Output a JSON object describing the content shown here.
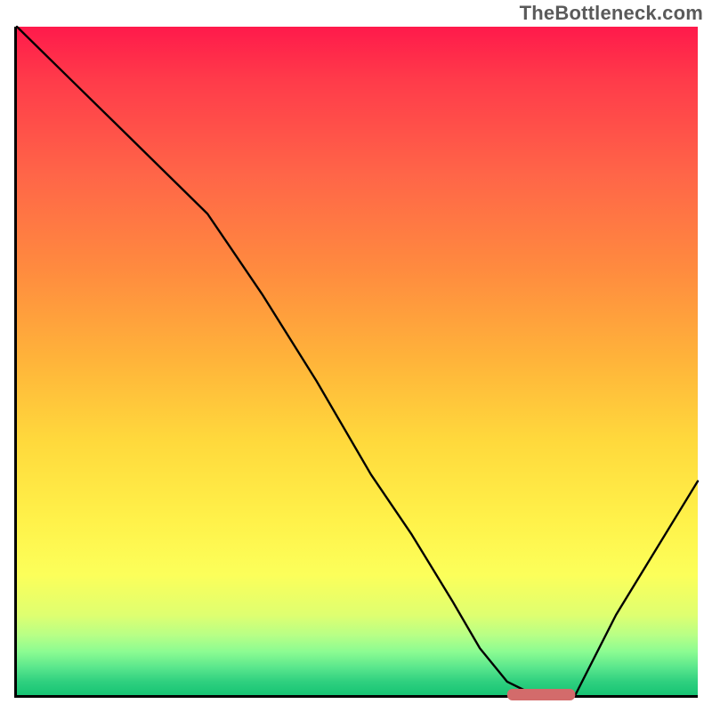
{
  "watermark": "TheBottleneck.com",
  "chart_data": {
    "type": "line",
    "title": "",
    "xlabel": "",
    "ylabel": "",
    "xlim": [
      0,
      100
    ],
    "ylim": [
      0,
      100
    ],
    "series": [
      {
        "name": "curve",
        "x": [
          0,
          8,
          16,
          22,
          28,
          36,
          44,
          52,
          58,
          64,
          68,
          72,
          76,
          82,
          88,
          94,
          100
        ],
        "y": [
          100,
          92,
          84,
          78,
          72,
          60,
          47,
          33,
          24,
          14,
          7,
          2,
          0,
          0,
          12,
          22,
          32
        ]
      }
    ],
    "marker": {
      "x_start": 72,
      "x_end": 82,
      "y": 0
    },
    "background": {
      "gradient_stops": [
        {
          "pos": 0,
          "color": "#ff1a4b"
        },
        {
          "pos": 0.5,
          "color": "#ffb43a"
        },
        {
          "pos": 0.82,
          "color": "#fcff5a"
        },
        {
          "pos": 1.0,
          "color": "#17c474"
        }
      ]
    }
  }
}
